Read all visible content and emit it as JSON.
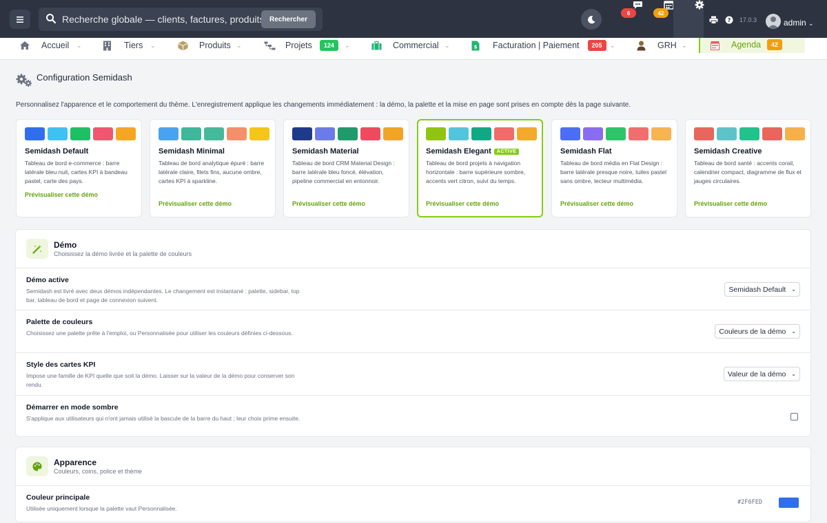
{
  "topbar": {
    "search_placeholder": "Recherche globale — clients, factures, produits...",
    "search_button": "Rechercher",
    "messages_badge": "6",
    "agenda_badge": "42",
    "version": "17.0.3",
    "username": "admin"
  },
  "nav": {
    "items": [
      {
        "label": "Accueil",
        "icon": "home-icon"
      },
      {
        "label": "Tiers",
        "icon": "building-icon"
      },
      {
        "label": "Produits",
        "icon": "box-icon"
      },
      {
        "label": "Projets",
        "icon": "project-icon",
        "badge": "124"
      },
      {
        "label": "Commercial",
        "icon": "briefcase-icon"
      },
      {
        "label": "Facturation | Paiement",
        "icon": "invoice-icon",
        "badge": "205"
      },
      {
        "label": "GRH",
        "icon": "user-icon"
      },
      {
        "label": "Agenda",
        "icon": "calendar-icon",
        "badge": "42"
      }
    ]
  },
  "page": {
    "title": "Configuration Semidash",
    "intro": "Personnalisez l'apparence et le comportement du thème. L'enregistrement applique les changements immédiatement : la démo, la palette et la mise en page sont prises en compte dès la page suivante."
  },
  "demos": [
    {
      "name": "Semidash Default",
      "desc": "Tableau de bord e-commerce : barre latérale bleu nuit, cartes KPI à bandeau pastel, carte des pays.",
      "link": "Prévisualiser cette démo",
      "colors": [
        "#2f6fed",
        "#3ec1f3",
        "#1fbf64",
        "#f0566f",
        "#f5a623"
      ]
    },
    {
      "name": "Semidash Minimal",
      "desc": "Tableau de bord analytique épuré : barre latérale claire, filets fins, aucune ombre, cartes KPI à sparkline.",
      "link": "Prévisualiser cette démo",
      "colors": [
        "#4aa3f0",
        "#3fb79a",
        "#46b99b",
        "#f48f6c",
        "#f5c518"
      ]
    },
    {
      "name": "Semidash Material",
      "desc": "Tableau de bord CRM Material Design : barre latérale bleu foncé, élévation, pipeline commercial en entonnoir.",
      "link": "Prévisualiser cette démo",
      "colors": [
        "#1e3a8a",
        "#6b7bea",
        "#1f9a6a",
        "#ee4b5f",
        "#f0a525"
      ]
    },
    {
      "name": "Semidash Elegant",
      "badge": "ACTIVE",
      "desc": "Tableau de bord projets à navigation horizontale : barre supérieure sombre, accents vert citron, suivi du temps.",
      "link": "Prévisualiser cette démo",
      "colors": [
        "#8fc412",
        "#52c5dc",
        "#10a986",
        "#f26b6b",
        "#f4a92a"
      ]
    },
    {
      "name": "Semidash Flat",
      "desc": "Tableau de bord média en Flat Design : barre latérale presque noire, tuiles pastel sans ombre, lecteur multimédia.",
      "link": "Prévisualiser cette démo",
      "colors": [
        "#4c6ef5",
        "#8a6cf0",
        "#2dc46a",
        "#f26d6d",
        "#f6b452"
      ]
    },
    {
      "name": "Semidash Creative",
      "desc": "Tableau de bord santé : accents corail, calendrier compact, diagramme de flux et jauges circulaires.",
      "link": "Prévisualiser cette démo",
      "colors": [
        "#e8665c",
        "#5ec3c9",
        "#21c28c",
        "#e8665c",
        "#f6b04a"
      ]
    }
  ],
  "demo_panel": {
    "title": "Démo",
    "subtitle": "Choisissez la démo livrée et la palette de couleurs",
    "rows": [
      {
        "label": "Démo active",
        "desc": "Semidash est livré avec deux démos indépendantes. Le changement est instantané : palette, sidebar, top bar, tableau de bord et page de connexion suivent.",
        "value": "Semidash Default"
      },
      {
        "label": "Palette de couleurs",
        "desc": "Choisissez une palette prête à l'emploi, ou Personnalisée pour utiliser les couleurs définies ci-dessous.",
        "value": "Couleurs de la démo"
      },
      {
        "label": "Style des cartes KPI",
        "desc": "Impose une famille de KPI quelle que soit la démo. Laisser sur la valeur de la démo pour conserver son rendu.",
        "value": "Valeur de la démo"
      },
      {
        "label": "Démarrer en mode sombre",
        "desc": "S'applique aux utilisateurs qui n'ont jamais utilisé la bascule de la barre du haut ; leur choix prime ensuite.",
        "checked": false
      }
    ]
  },
  "appearance_panel": {
    "title": "Apparence",
    "subtitle": "Couleurs, coins, police et thème",
    "rows": [
      {
        "label": "Couleur principale",
        "desc": "Utilisée uniquement lorsque la palette vaut Personnalisée.",
        "hex": "#2F6FED",
        "color": "#2f6fed"
      }
    ]
  }
}
